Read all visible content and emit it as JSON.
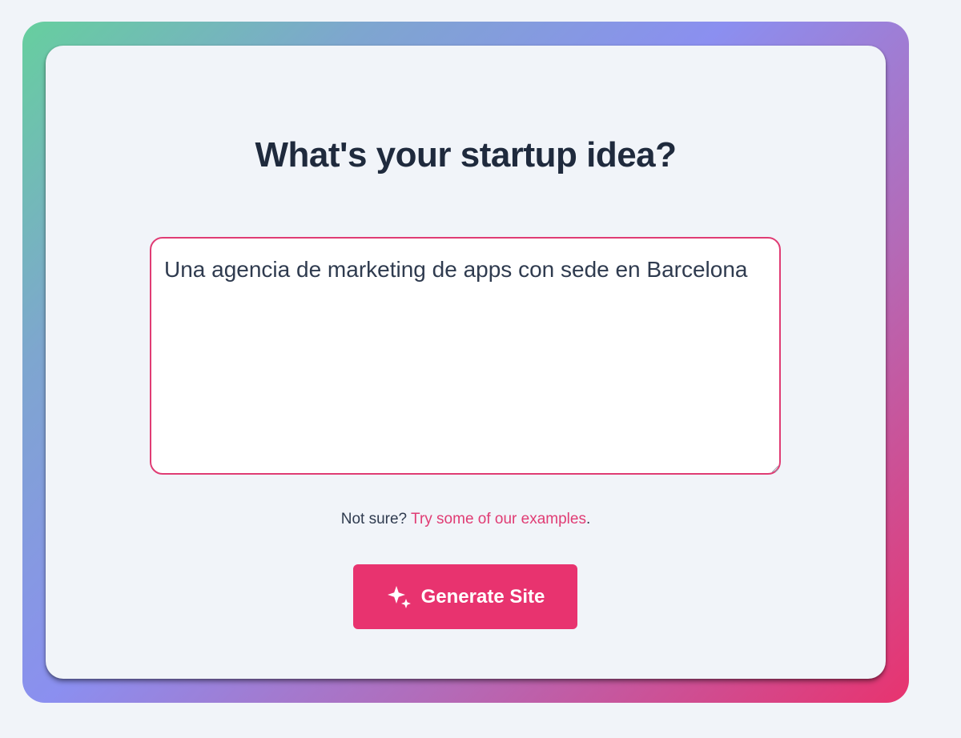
{
  "page": {
    "title": "What's your startup idea?"
  },
  "idea_input": {
    "value": "Una agencia de marketing de apps con sede en Barcelona"
  },
  "hint": {
    "prefix": "Not sure? ",
    "link_label": "Try some of our examples",
    "suffix": "."
  },
  "generate_button": {
    "label": "Generate Site",
    "icon": "sparkles-icon"
  },
  "colors": {
    "accent": "#e8336f",
    "title_text": "#1f2a3d",
    "body_text": "#2f3b4f",
    "background": "#f1f4f9"
  }
}
